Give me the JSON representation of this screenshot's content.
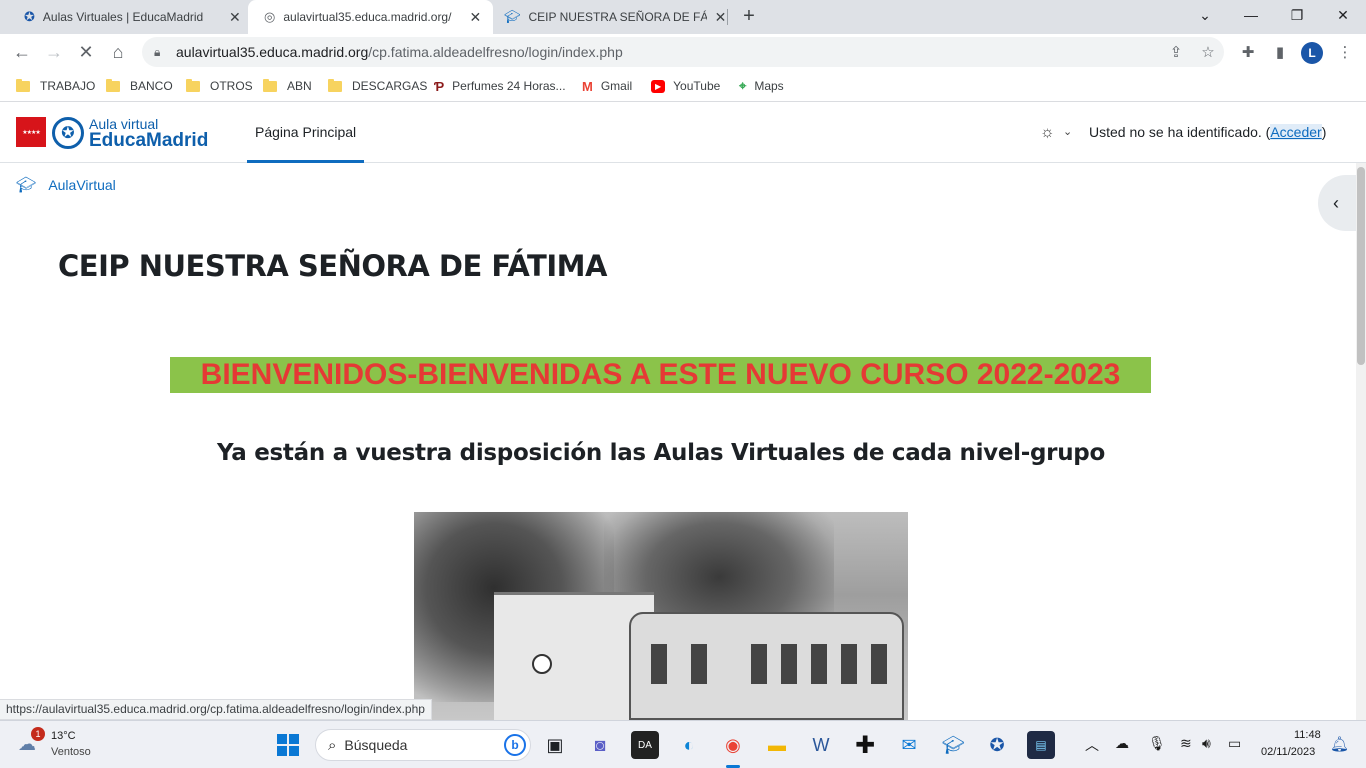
{
  "browser": {
    "tabs": [
      {
        "title": "Aulas Virtuales | EducaMadrid",
        "active": false
      },
      {
        "title": "aulavirtual35.educa.madrid.org/",
        "active": true
      },
      {
        "title": "CEIP NUESTRA SEÑORA DE FÁTIM",
        "active": false
      }
    ],
    "new_tab_icon": "plus-icon",
    "url_host": "aulavirtual35.educa.madrid.org",
    "url_path": "/cp.fatima.aldeadelfresno/login/index.php",
    "profile_initial": "L",
    "bookmarks": [
      {
        "label": "TRABAJO",
        "icon": "folder-icon"
      },
      {
        "label": "BANCO",
        "icon": "folder-icon"
      },
      {
        "label": "OTROS",
        "icon": "folder-icon"
      },
      {
        "label": "ABN",
        "icon": "folder-icon"
      },
      {
        "label": "DESCARGAS",
        "icon": "folder-icon"
      },
      {
        "label": "Perfumes 24 Horas...",
        "icon": "perfume-icon"
      },
      {
        "label": "Gmail",
        "icon": "gmail-icon"
      },
      {
        "label": "YouTube",
        "icon": "youtube-icon"
      },
      {
        "label": "Maps",
        "icon": "maps-icon"
      }
    ],
    "status_url": "https://aulavirtual35.educa.madrid.org/cp.fatima.aldeadelfresno/login/index.php"
  },
  "site": {
    "logo_small": "Aula virtual",
    "logo_big": "EducaMadrid",
    "nav_home": "Página Principal",
    "login_prefix": "Usted no se ha identificado. (",
    "login_link": "Acceder",
    "login_suffix": ")"
  },
  "content": {
    "breadcrumb": "AulaVirtual",
    "title": "CEIP NUESTRA SEÑORA DE FÁTIMA",
    "welcome": "BIENVENIDOS-BIENVENIDAS A ESTE NUEVO CURSO 2022-2023",
    "subtitle": "Ya están a vuestra disposición las Aulas Virtuales de cada nivel-grupo",
    "colors": {
      "welcome_bg": "#8bc34a",
      "welcome_text": "#e53935",
      "link": "#0f6cbf"
    }
  },
  "taskbar": {
    "weather_badge": "1",
    "weather_temp": "13°C",
    "weather_desc": "Ventoso",
    "search_placeholder": "Búsqueda",
    "time": "11:48",
    "date": "02/11/2023"
  }
}
